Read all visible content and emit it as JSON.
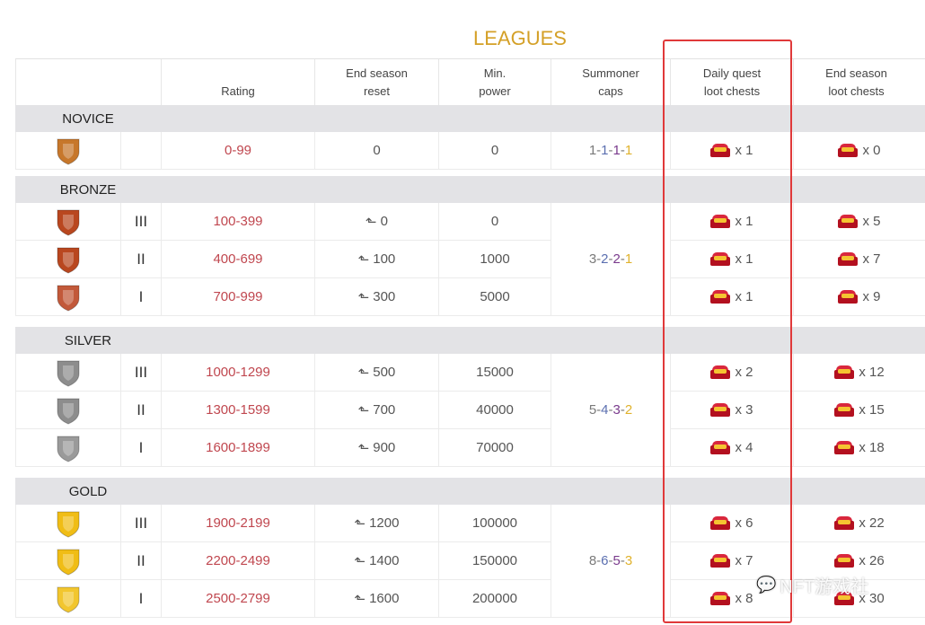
{
  "title": "LEAGUES",
  "headers": {
    "rating": "Rating",
    "end_reset_l1": "End season",
    "end_reset_l2": "reset",
    "min_power_l1": "Min.",
    "min_power_l2": "power",
    "caps_l1": "Summoner",
    "caps_l2": "caps",
    "daily_l1": "Daily quest",
    "daily_l2": "loot chests",
    "endchest_l1": "End season",
    "endchest_l2": "loot chests"
  },
  "sections": [
    {
      "name": "NOVICE",
      "caps": [
        "1",
        "1",
        "1",
        "1"
      ],
      "rows": [
        {
          "badge": "novice-shield",
          "tier": "",
          "rating": "0-99",
          "reset": "0",
          "reset_arrow": false,
          "power": "0",
          "daily": "x 1",
          "end": "x 0",
          "color": "#c7772b"
        }
      ]
    },
    {
      "name": "BRONZE",
      "caps": [
        "3",
        "2",
        "2",
        "1"
      ],
      "rows": [
        {
          "badge": "bronze-shield-3",
          "tier": "III",
          "rating": "100-399",
          "reset": "0",
          "reset_arrow": true,
          "power": "0",
          "daily": "x 1",
          "end": "x 5",
          "color": "#b9471f"
        },
        {
          "badge": "bronze-shield-2",
          "tier": "II",
          "rating": "400-699",
          "reset": "100",
          "reset_arrow": true,
          "power": "1000",
          "daily": "x 1",
          "end": "x 7",
          "color": "#b9471f"
        },
        {
          "badge": "bronze-shield-1",
          "tier": "I",
          "rating": "700-999",
          "reset": "300",
          "reset_arrow": true,
          "power": "5000",
          "daily": "x 1",
          "end": "x 9",
          "color": "#c2593a"
        }
      ]
    },
    {
      "name": "SILVER",
      "caps": [
        "5",
        "4",
        "3",
        "2"
      ],
      "rows": [
        {
          "badge": "silver-shield-3",
          "tier": "III",
          "rating": "1000-1299",
          "reset": "500",
          "reset_arrow": true,
          "power": "15000",
          "daily": "x 2",
          "end": "x 12",
          "color": "#8d8d8d"
        },
        {
          "badge": "silver-shield-2",
          "tier": "II",
          "rating": "1300-1599",
          "reset": "700",
          "reset_arrow": true,
          "power": "40000",
          "daily": "x 3",
          "end": "x 15",
          "color": "#8d8d8d"
        },
        {
          "badge": "silver-shield-1",
          "tier": "I",
          "rating": "1600-1899",
          "reset": "900",
          "reset_arrow": true,
          "power": "70000",
          "daily": "x 4",
          "end": "x 18",
          "color": "#9a9a9a"
        }
      ]
    },
    {
      "name": "GOLD",
      "caps": [
        "8",
        "6",
        "5",
        "3"
      ],
      "rows": [
        {
          "badge": "gold-shield-3",
          "tier": "III",
          "rating": "1900-2199",
          "reset": "1200",
          "reset_arrow": true,
          "power": "100000",
          "daily": "x 6",
          "end": "x 22",
          "color": "#f0bd16"
        },
        {
          "badge": "gold-shield-2",
          "tier": "II",
          "rating": "2200-2499",
          "reset": "1400",
          "reset_arrow": true,
          "power": "150000",
          "daily": "x 7",
          "end": "x 26",
          "color": "#f0bd16"
        },
        {
          "badge": "gold-shield-1",
          "tier": "I",
          "rating": "2500-2799",
          "reset": "1600",
          "reset_arrow": true,
          "power": "200000",
          "daily": "x 8",
          "end": "x 30",
          "color": "#f2c62e"
        }
      ]
    }
  ],
  "caps_colors": [
    "#7a7a7a",
    "#5b6fb0",
    "#7a3b8d",
    "#e0b22c"
  ],
  "highlight_color": "#e0393a",
  "watermark": "NFT游戏社"
}
